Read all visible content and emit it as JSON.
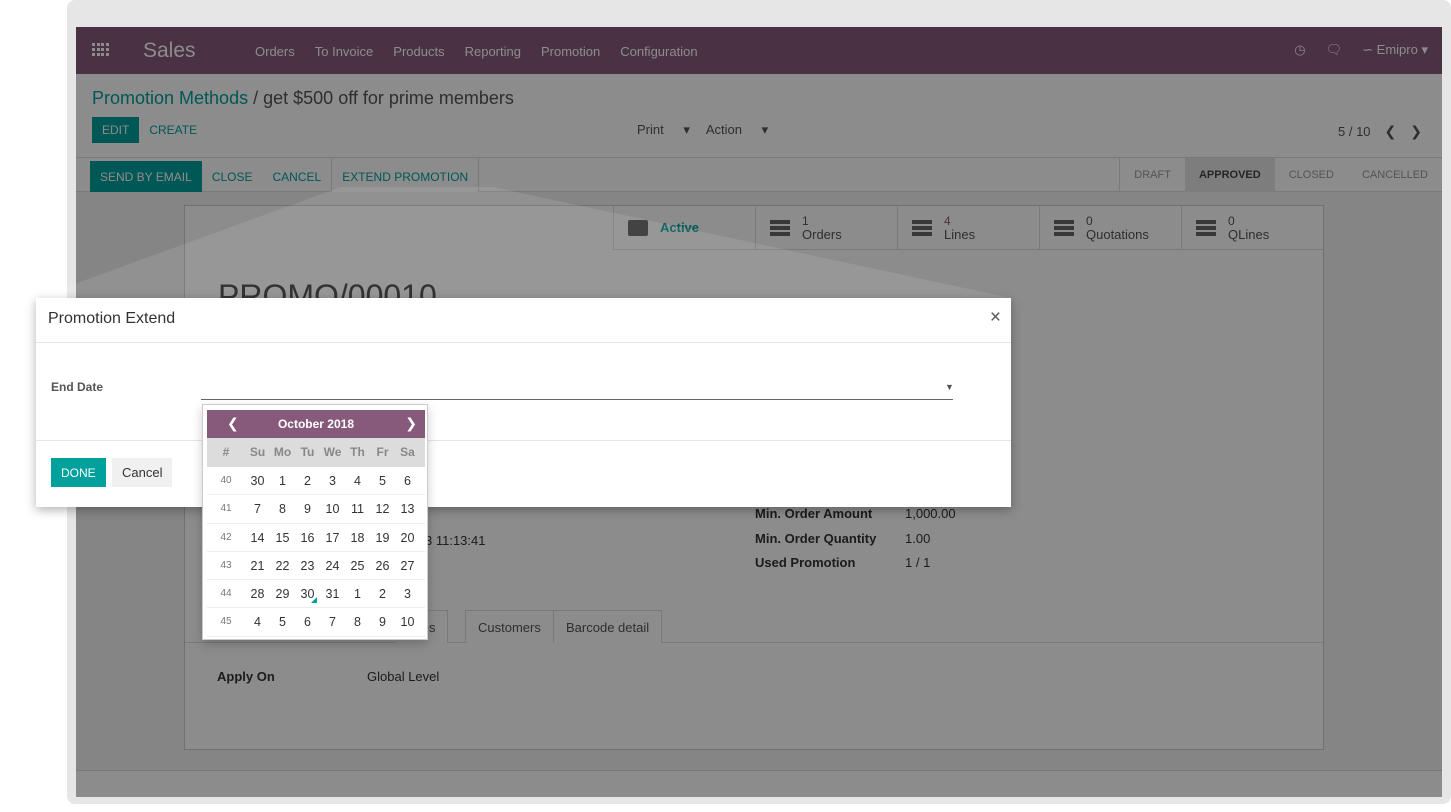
{
  "navbar": {
    "brand": "Sales",
    "menu": [
      "Orders",
      "To Invoice",
      "Products",
      "Reporting",
      "Promotion",
      "Configuration"
    ],
    "user": "Emipro",
    "colors": {
      "primary": "#875a7b",
      "accent": "#00a09d"
    }
  },
  "breadcrumb": {
    "parent": "Promotion Methods",
    "separator": "/",
    "current": "get $500 off for prime members"
  },
  "controls": {
    "edit": "EDIT",
    "create": "CREATE",
    "print": "Print",
    "action": "Action",
    "pager": "5 / 10"
  },
  "statusbar": {
    "buttons": [
      "SEND BY EMAIL",
      "CLOSE",
      "CANCEL",
      "EXTEND PROMOTION"
    ],
    "stages": [
      "DRAFT",
      "APPROVED",
      "CLOSED",
      "CANCELLED"
    ],
    "active_stage": "APPROVED"
  },
  "smart_buttons": [
    {
      "num": "",
      "label": "Active",
      "icon": "archive-icon"
    },
    {
      "num": "1",
      "label": "Orders",
      "icon": "list-icon"
    },
    {
      "num": "4",
      "label": "Lines",
      "icon": "list-icon"
    },
    {
      "num": "0",
      "label": "Quotations",
      "icon": "list-icon"
    },
    {
      "num": "0",
      "label": "QLines",
      "icon": "list-icon"
    }
  ],
  "record": {
    "title": "PROMO/00010",
    "date_partial": "3 11:13:41",
    "fields_right": [
      {
        "label": "Min. Order Amount",
        "value": "1,000.00"
      },
      {
        "label": "Min. Order Quantity",
        "value": "1.00"
      },
      {
        "label": "Used Promotion",
        "value": "1 / 1"
      }
    ],
    "tabs": [
      "ypes",
      "Customers",
      "Barcode detail"
    ],
    "apply_on_label": "Apply On",
    "apply_on_value": "Global Level"
  },
  "dialog": {
    "title": "Promotion Extend",
    "field_label": "End Date",
    "field_value": "",
    "done": "DONE",
    "cancel": "Cancel"
  },
  "datepicker": {
    "month": "October 2018",
    "dow": [
      "#",
      "Su",
      "Mo",
      "Tu",
      "We",
      "Th",
      "Fr",
      "Sa"
    ],
    "weeks": [
      {
        "wk": "40",
        "days": [
          "30",
          "1",
          "2",
          "3",
          "4",
          "5",
          "6"
        ]
      },
      {
        "wk": "41",
        "days": [
          "7",
          "8",
          "9",
          "10",
          "11",
          "12",
          "13"
        ]
      },
      {
        "wk": "42",
        "days": [
          "14",
          "15",
          "16",
          "17",
          "18",
          "19",
          "20"
        ]
      },
      {
        "wk": "43",
        "days": [
          "21",
          "22",
          "23",
          "24",
          "25",
          "26",
          "27"
        ]
      },
      {
        "wk": "44",
        "days": [
          "28",
          "29",
          "30",
          "31",
          "1",
          "2",
          "3"
        ]
      },
      {
        "wk": "45",
        "days": [
          "4",
          "5",
          "6",
          "7",
          "8",
          "9",
          "10"
        ]
      }
    ],
    "today": "30"
  }
}
